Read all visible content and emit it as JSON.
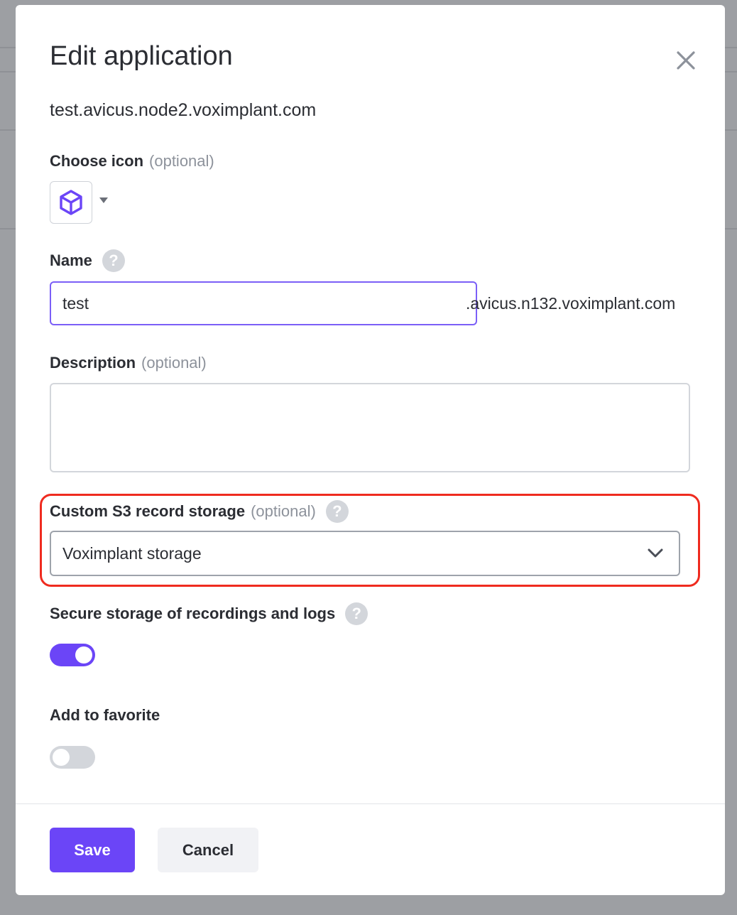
{
  "dialog": {
    "title": "Edit application",
    "subtitle": "test.avicus.node2.voximplant.com"
  },
  "icon_field": {
    "label": "Choose icon",
    "optional": "(optional)",
    "selected_icon": "cube-icon"
  },
  "name_field": {
    "label": "Name",
    "value": "test",
    "suffix": ".avicus.n132.voximplant.com",
    "help": "?"
  },
  "description_field": {
    "label": "Description",
    "optional": "(optional)",
    "value": ""
  },
  "storage_field": {
    "label": "Custom S3 record storage",
    "optional": "(optional)",
    "help": "?",
    "selected": "Voximplant storage"
  },
  "secure_storage": {
    "label": "Secure storage of recordings and logs",
    "help": "?",
    "enabled": true
  },
  "favorite": {
    "label": "Add to favorite",
    "enabled": false
  },
  "footer": {
    "save_label": "Save",
    "cancel_label": "Cancel"
  },
  "colors": {
    "accent": "#6b45f7",
    "highlight": "#ef2b1f",
    "toggle_off": "#d3d6db"
  }
}
